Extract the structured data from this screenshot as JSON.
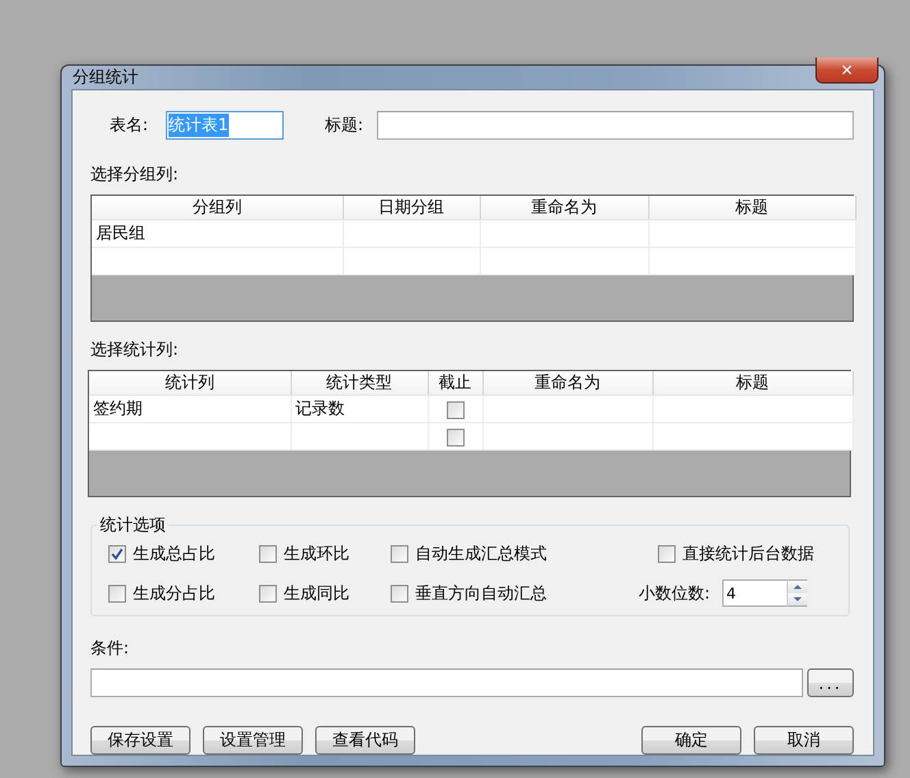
{
  "window": {
    "title": "分组统计",
    "close": "✕"
  },
  "name_field": {
    "label": "表名:",
    "value": "统计表1",
    "text_selected": true
  },
  "title_field": {
    "label": "标题:"
  },
  "group_section": {
    "label": "选择分组列:",
    "columns": [
      {
        "label": "分组列",
        "kind": "text"
      },
      {
        "label": "日期分组",
        "kind": "text"
      },
      {
        "label": "重命名为",
        "kind": "text"
      },
      {
        "label": "标题",
        "kind": "text"
      }
    ],
    "rows": [
      {
        "cells": [
          {
            "text": "居民组"
          },
          {},
          {},
          {}
        ]
      },
      {
        "cells": [
          {},
          {},
          {},
          {}
        ]
      }
    ]
  },
  "stat_section": {
    "label": "选择统计列:",
    "columns": [
      {
        "label": "统计列",
        "kind": "text"
      },
      {
        "label": "统计类型",
        "kind": "text"
      },
      {
        "label": "截止",
        "kind": "checkbox"
      },
      {
        "label": "重命名为",
        "kind": "text"
      },
      {
        "label": "标题",
        "kind": "text"
      }
    ],
    "rows": [
      {
        "cells": [
          {
            "text": "签约期"
          },
          {
            "text": "记录数"
          },
          {
            "checked": false
          },
          {},
          {}
        ]
      },
      {
        "cells": [
          {},
          {},
          {
            "checked": false
          },
          {},
          {}
        ]
      }
    ]
  },
  "options": {
    "title": "统计选项",
    "items": [
      {
        "label": "生成总占比",
        "checked": true
      },
      {
        "label": "生成环比",
        "checked": false
      },
      {
        "label": "自动生成汇总模式",
        "checked": false
      },
      {
        "label": "直接统计后台数据",
        "checked": false
      },
      {
        "label": "生成分占比",
        "checked": false
      },
      {
        "label": "生成同比",
        "checked": false
      },
      {
        "label": "垂直方向自动汇总",
        "checked": false
      }
    ],
    "decimals": {
      "label": "小数位数:",
      "value": "4"
    }
  },
  "condition": {
    "label": "条件:",
    "browse": "..."
  },
  "buttons_left": [
    "保存设置",
    "设置管理",
    "查看代码"
  ],
  "buttons_right": [
    "确定",
    "取消"
  ]
}
